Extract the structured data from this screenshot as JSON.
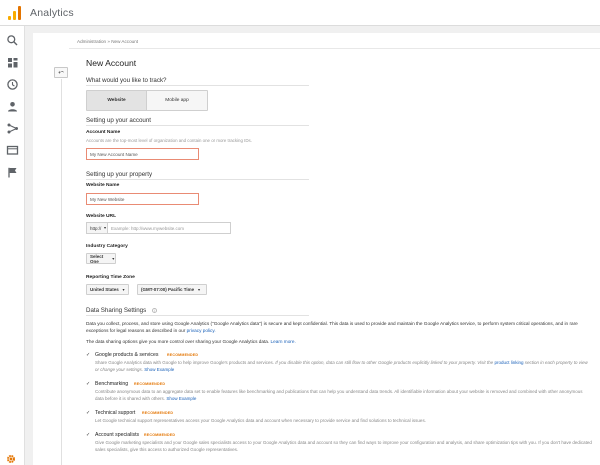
{
  "app": {
    "title": "Analytics"
  },
  "nav": {
    "icons": [
      "search-icon",
      "dashboard-icon",
      "clock-icon",
      "person-icon",
      "fork-icon",
      "display-icon",
      "flag-icon"
    ],
    "settings_icon": "gear-icon"
  },
  "breadcrumb": "Administration » New Account",
  "page_title": "New Account",
  "track": {
    "heading": "What would you like to track?",
    "options": [
      "Website",
      "Mobile app"
    ],
    "selected": "Website"
  },
  "account": {
    "heading": "Setting up your account",
    "name_label": "Account Name",
    "name_hint": "Accounts are the top-most level of organization and contain one or more tracking IDs.",
    "name_placeholder": "My New Account Name"
  },
  "property": {
    "heading": "Setting up your property",
    "website_name_label": "Website Name",
    "website_name_placeholder": "My New Website",
    "url_label": "Website URL",
    "url_protocol": "http://",
    "url_placeholder": "Example: http://www.mywebsite.com",
    "industry_label": "Industry Category",
    "industry_value": "Select One",
    "tz_label": "Reporting Time Zone",
    "tz_country": "United States",
    "tz_zone": "(GMT-07:00) Pacific Time"
  },
  "sharing": {
    "heading": "Data Sharing Settings",
    "intro_1": "Data you collect, process, and store using Google Analytics (\"Google Analytics data\") is secure and kept confidential. This data is used to provide and maintain the Google Analytics service, to perform system critical operations, and in rare exceptions for legal reasons as described in our",
    "intro_link": "privacy policy.",
    "intro_2": "The data sharing options give you more control over sharing your Google Analytics data.",
    "intro_2_link": "Learn more.",
    "recommended": "RECOMMENDED",
    "options": [
      {
        "label": "Google products & services",
        "desc_a": "Share Google Analytics data with Google to help improve Google's products and services.",
        "desc_b": "If you disable this option, data can still flow to other Google products explicitly linked to your property. Visit the",
        "desc_link": "product linking",
        "desc_c": "section in each property to view or change your settings.",
        "desc_link2": "Show Example"
      },
      {
        "label": "Benchmarking",
        "desc_a": "Contribute anonymous data to an aggregate data set to enable features like benchmarking and publications that can help you understand data trends. All identifiable information about your website is removed and combined with other anonymous data before it is shared with others.",
        "desc_link": "Show Example"
      },
      {
        "label": "Technical support",
        "desc_a": "Let Google technical support representatives access your Google Analytics data and account when necessary to provide service and find solutions to technical issues."
      },
      {
        "label": "Account specialists",
        "desc_a": "Give Google marketing specialists and your Google sales specialists access to your Google Analytics data and account so they can find ways to improve your configuration and analysis, and share optimization tips with you. If you don't have dedicated sales specialists, give this access to authorized Google representatives."
      }
    ]
  },
  "colors": {
    "accent": "#e37400",
    "logo": "#f9ab00",
    "link": "#1a61b9",
    "field_border": "#e98b74"
  }
}
